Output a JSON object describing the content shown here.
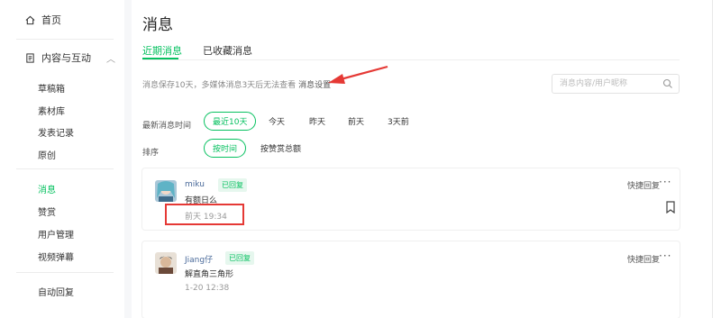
{
  "sidebar": {
    "home": "首页",
    "group": "内容与互动",
    "items": [
      "草稿箱",
      "素材库",
      "发表记录",
      "原创",
      "消息",
      "赞赏",
      "用户管理",
      "视频弹幕",
      "自动回复"
    ],
    "active_index": 4
  },
  "main": {
    "title": "消息",
    "tabs": [
      "近期消息",
      "已收藏消息"
    ],
    "active_tab": 0,
    "notice_text": "消息保存10天，多媒体消息3天后无法查看",
    "notice_link": "消息设置",
    "search_placeholder": "消息内容/用户昵称",
    "filters": {
      "time_label": "最新消息时间",
      "time_options": [
        "最近10天",
        "今天",
        "昨天",
        "前天",
        "3天前"
      ],
      "sort_label": "排序",
      "sort_options": [
        "按时间",
        "按赞赏总额"
      ]
    }
  },
  "messages": [
    {
      "name": "miku",
      "badge": "已回复",
      "text": "有额日么",
      "time": "前天 19:34",
      "quick_reply": "快捷回复",
      "more": "···"
    },
    {
      "name": "Jiang仔",
      "badge": "已回复",
      "text": "解直角三角形",
      "time": "1-20 12:38",
      "quick_reply": "快捷回复",
      "more": "···"
    }
  ],
  "colors": {
    "accent": "#07c160",
    "highlight": "#e53935"
  }
}
